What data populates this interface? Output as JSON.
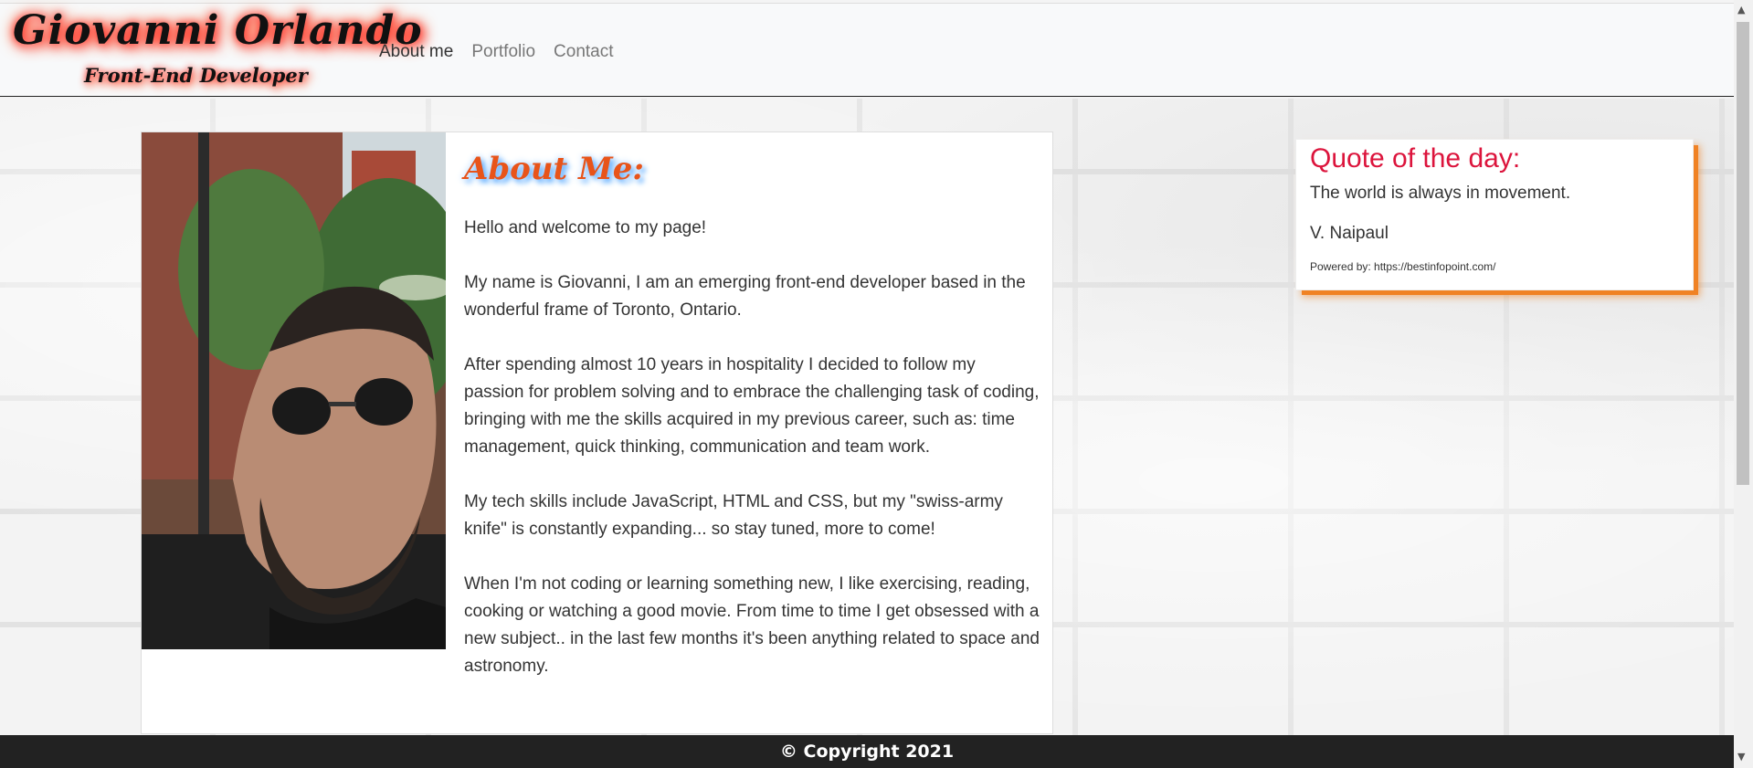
{
  "header": {
    "brand_name": "Giovanni Orlando",
    "brand_subtitle": "Front-End Developer",
    "nav": [
      {
        "label": "About me",
        "active": true
      },
      {
        "label": "Portfolio",
        "active": false
      },
      {
        "label": "Contact",
        "active": false
      }
    ]
  },
  "about": {
    "title": "About Me:",
    "paragraphs": [
      "Hello and welcome to my page!",
      "My name is Giovanni, I am an emerging front-end developer based in the wonderful frame of Toronto, Ontario.",
      "After spending almost 10 years in hospitality I decided to follow my passion for problem solving and to embrace the challenging task of coding, bringing with me the skills acquired in my previous career, such as: time management, quick thinking, communication and team work.",
      "My tech skills include JavaScript, HTML and CSS, but my \"swiss-army knife\" is constantly expanding... so stay tuned, more to come!",
      "When I'm not coding or learning something new, I like exercising, reading, cooking or watching a good movie. From time to time I get obsessed with a new subject.. in the last few months it's been anything related to space and astronomy."
    ]
  },
  "quote": {
    "title": "Quote of the day:",
    "text": "The world is always in movement.",
    "author": "V. Naipaul",
    "powered_by": "Powered by: https://bestinfopoint.com/"
  },
  "footer": {
    "copyright": "© Copyright 2021"
  },
  "colors": {
    "about_title": "#e8541a",
    "quote_title": "#dc143c",
    "quote_shadow": "#f08224",
    "footer_bg": "#222222"
  }
}
